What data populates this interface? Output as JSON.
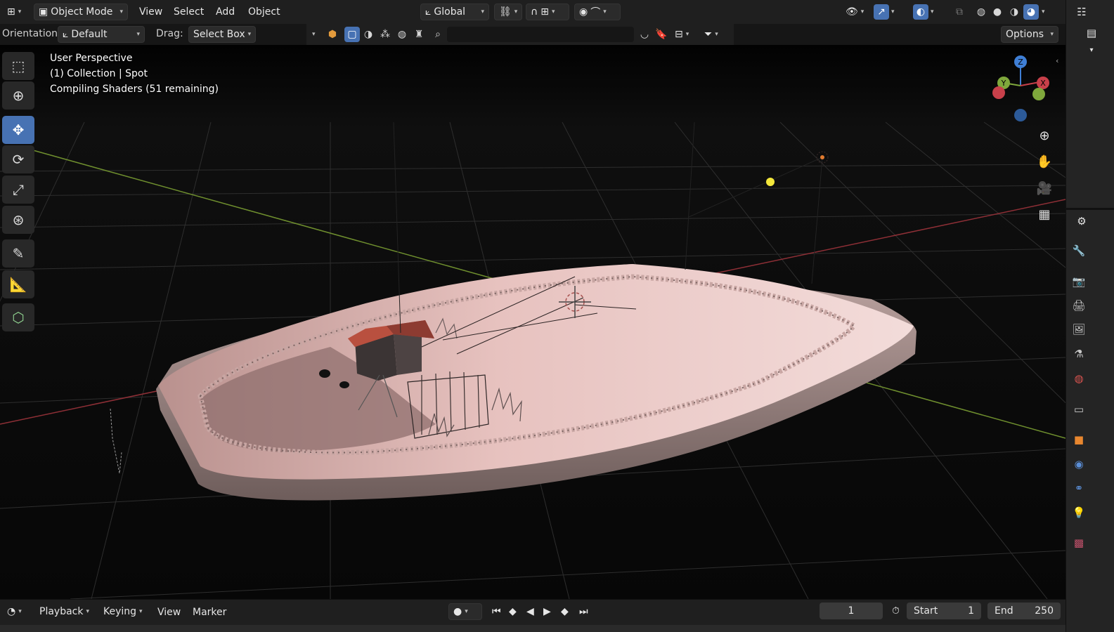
{
  "header": {
    "editor_type_icon": "editor-type-icon",
    "mode": "Object Mode",
    "menus": [
      "View",
      "Select",
      "Add",
      "Object"
    ],
    "transform_orientation": "Global"
  },
  "tool_settings": {
    "orientation_label": "Orientation:",
    "orientation_value": "Default",
    "drag_label": "Drag:",
    "drag_value": "Select Box",
    "options_label": "Options"
  },
  "viewport": {
    "perspective": "User Perspective",
    "collection": "(1) Collection | Spot",
    "status": "Compiling Shaders (51 remaining)",
    "gizmo": {
      "z": "Z",
      "y": "Y",
      "x": "X"
    }
  },
  "timeline": {
    "menus": [
      "Playback",
      "Keying",
      "View",
      "Marker"
    ],
    "current_frame": "1",
    "start_label": "Start",
    "start_value": "1",
    "end_label": "End",
    "end_value": "250"
  },
  "colors": {
    "accent": "#4772b3",
    "x_axis": "#c8404a",
    "y_axis": "#7fa83c",
    "z_axis": "#3f7fd6",
    "terrain": "#e9c4c0"
  }
}
